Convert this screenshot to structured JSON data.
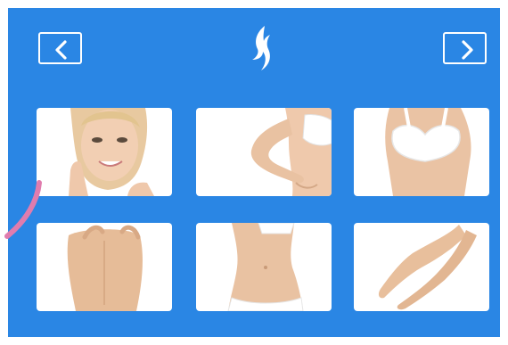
{
  "colors": {
    "screen_background": "#2a86e4",
    "icon_stroke": "#ffffff",
    "tile_background": "#ffffff",
    "skin": "#e9c2a2",
    "trail": "#e07cae"
  },
  "header": {
    "prev_icon": "chevron-left-icon",
    "next_icon": "chevron-right-icon",
    "logo_icon": "woman-silhouette-logo"
  },
  "body_areas": [
    {
      "icon": "face-area-image"
    },
    {
      "icon": "arm-area-image"
    },
    {
      "icon": "chest-area-image"
    },
    {
      "icon": "back-area-image"
    },
    {
      "icon": "abdomen-area-image"
    },
    {
      "icon": "legs-area-image"
    }
  ]
}
